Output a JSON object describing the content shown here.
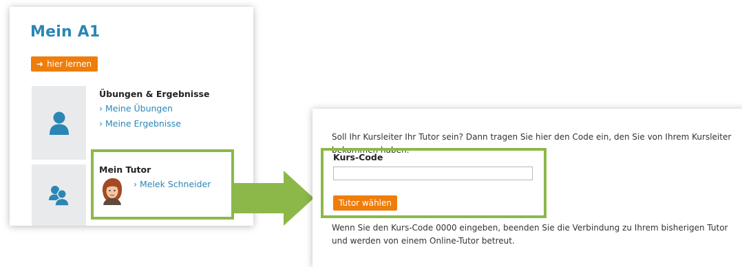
{
  "left_card": {
    "title": "Mein A1",
    "learn_button": "hier lernen",
    "exercises": {
      "heading": "Übungen & Ergebnisse",
      "link_exercises": "› Meine Übungen",
      "link_results": "› Meine Ergebnisse"
    },
    "tutor": {
      "heading": "Mein Tutor",
      "name_link": "› Melek Schneider"
    }
  },
  "right_card": {
    "intro": "Soll Ihr Kursleiter Ihr Tutor sein? Dann tragen Sie hier den Code ein, den Sie von Ihrem Kursleiter bekommen haben.",
    "code_label": "Kurs-Code",
    "code_value": "",
    "button": "Tutor wählen",
    "footer": "Wenn Sie den Kurs-Code 0000 eingeben, beenden Sie die Verbindung zu Ihrem bisherigen Tutor und werden von einem Online-Tutor betreut."
  },
  "icons": {
    "person": "person-icon",
    "group": "group-icon",
    "avatar": "tutor-avatar",
    "arrow": "arrow-right-icon"
  },
  "colors": {
    "accent_blue": "#2a86b5",
    "button_orange": "#f07d0a",
    "highlight_green": "#8cb84a",
    "icon_bg": "#e9eaec"
  }
}
